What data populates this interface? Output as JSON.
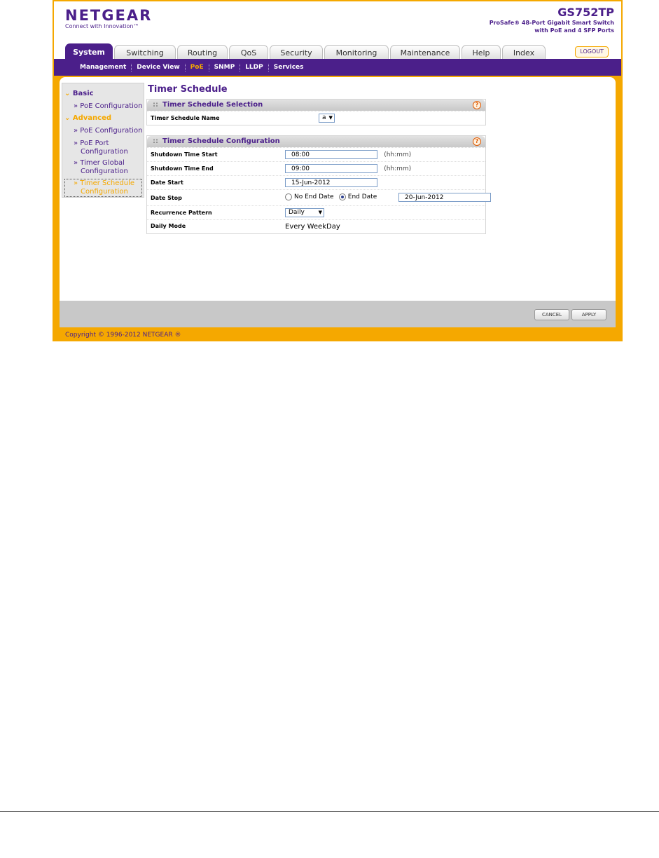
{
  "header": {
    "logo": "NETGEAR",
    "tagline": "Connect with Innovation™",
    "model": "GS752TP",
    "desc_line1": "ProSafe® 48-Port Gigabit Smart Switch",
    "desc_line2": "with PoE and 4 SFP Ports"
  },
  "tabs": [
    {
      "label": "System",
      "active": true
    },
    {
      "label": "Switching"
    },
    {
      "label": "Routing"
    },
    {
      "label": "QoS"
    },
    {
      "label": "Security"
    },
    {
      "label": "Monitoring"
    },
    {
      "label": "Maintenance"
    },
    {
      "label": "Help"
    },
    {
      "label": "Index"
    }
  ],
  "logout_label": "LOGOUT",
  "subnav": [
    {
      "label": "Management"
    },
    {
      "label": "Device View"
    },
    {
      "label": "PoE",
      "active": true
    },
    {
      "label": "SNMP"
    },
    {
      "label": "LLDP"
    },
    {
      "label": "Services"
    }
  ],
  "leftnav": {
    "basic": "Basic",
    "basic_poe": "» PoE Configuration",
    "advanced": "Advanced",
    "adv_poe": "» PoE Configuration",
    "adv_port_1": "» PoE Port",
    "adv_port_2": "Configuration",
    "adv_global_1": "» Timer Global",
    "adv_global_2": "Configuration",
    "adv_sched_1": "» Timer Schedule",
    "adv_sched_2": "Configuration",
    "chev": "⌄"
  },
  "page": {
    "title": "Timer Schedule",
    "selection": {
      "header": "Timer Schedule Selection",
      "name_label": "Timer Schedule Name",
      "name_value": "a"
    },
    "config": {
      "header": "Timer Schedule Configuration",
      "start_label": "Shutdown Time Start",
      "start_value": "08:00",
      "end_label": "Shutdown Time End",
      "end_value": "09:00",
      "unit": "(hh:mm)",
      "date_start_label": "Date Start",
      "date_start_value": "15-Jun-2012",
      "date_stop_label": "Date Stop",
      "no_end_label": "No End Date",
      "end_date_label": "End Date",
      "end_date_value": "20-Jun-2012",
      "recurrence_label": "Recurrence Pattern",
      "recurrence_value": "Daily",
      "daily_label": "Daily Mode",
      "daily_value": "Every WeekDay"
    },
    "help_glyph": "?",
    "drag_dots": "::"
  },
  "buttons": {
    "cancel": "CANCEL",
    "apply": "APPLY"
  },
  "copyright": "Copyright © 1996-2012 NETGEAR ®",
  "colors": {
    "brand_purple": "#4b1f8a",
    "brand_orange": "#f5a800"
  }
}
